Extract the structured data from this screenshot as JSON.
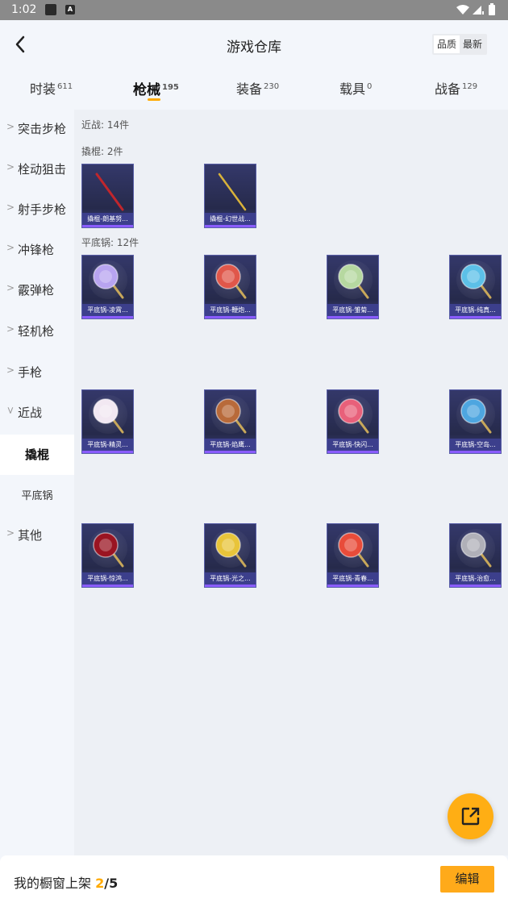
{
  "status_bar": {
    "time": "1:02",
    "app_icon_letter": "A"
  },
  "header": {
    "title": "游戏仓库",
    "sort_options": [
      "品质",
      "最新"
    ]
  },
  "tabs": [
    {
      "label": "时装",
      "count": "611"
    },
    {
      "label": "枪械",
      "count": "195"
    },
    {
      "label": "装备",
      "count": "230"
    },
    {
      "label": "载具",
      "count": "0"
    },
    {
      "label": "战备",
      "count": "129"
    }
  ],
  "sidebar": [
    {
      "label": "突击步枪"
    },
    {
      "label": "栓动狙击"
    },
    {
      "label": "射手步枪"
    },
    {
      "label": "冲锋枪"
    },
    {
      "label": "霰弹枪"
    },
    {
      "label": "轻机枪"
    },
    {
      "label": "手枪"
    },
    {
      "label": "近战"
    },
    {
      "label": "撬棍"
    },
    {
      "label": "平底锅"
    },
    {
      "label": "其他"
    }
  ],
  "content": {
    "melee_heading": "近战: 14件",
    "crowbar_heading": "撬棍: 2件",
    "pan_heading": "平底锅: 12件",
    "crowbars": [
      {
        "name": "撬棍-朗基努...",
        "color": "#c0262c"
      },
      {
        "name": "撬棍-幻世战...",
        "color": "#d8b23a"
      }
    ],
    "pans": [
      {
        "name": "平底锅-凌霄...",
        "color": "#b8a4f0"
      },
      {
        "name": "平底锅-鞭炮...",
        "color": "#e0574a"
      },
      {
        "name": "平底锅-雏菊...",
        "color": "#b6d8a0"
      },
      {
        "name": "平底锅-纯真...",
        "color": "#5cc0e8"
      },
      {
        "name": "平底锅-精灵...",
        "color": "#f2e8f2"
      },
      {
        "name": "平底锅-焰鹰...",
        "color": "#b86a3a"
      },
      {
        "name": "平底锅-快闪...",
        "color": "#e8607a"
      },
      {
        "name": "平底锅-空岛...",
        "color": "#4ea6e0"
      },
      {
        "name": "平底锅-惊鸿...",
        "color": "#9a1422"
      },
      {
        "name": "平底锅-光之...",
        "color": "#e8c43a"
      },
      {
        "name": "平底锅-青春...",
        "color": "#e84c3a"
      },
      {
        "name": "平底锅-治愈...",
        "color": "#b0b0b8"
      }
    ]
  },
  "bottom_bar": {
    "prefix": "我的橱窗上架",
    "current": "2",
    "total": "/5",
    "edit_label": "编辑"
  },
  "colors": {
    "accent": "#ffaa00",
    "card_bg": "#2b2f52",
    "card_bar": "#8a5cff"
  }
}
